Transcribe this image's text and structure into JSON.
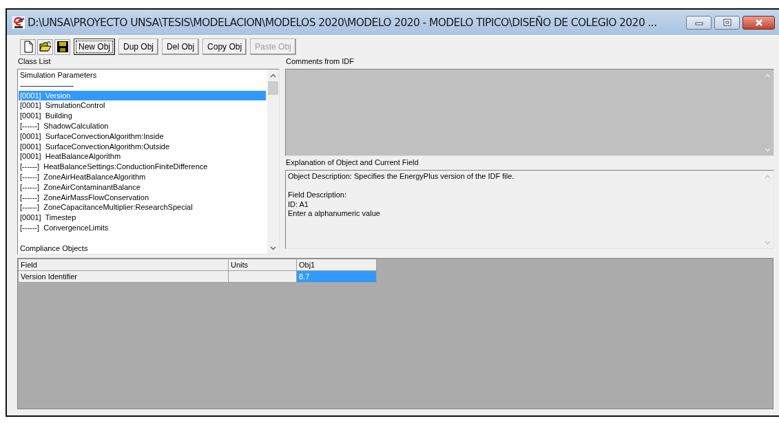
{
  "window": {
    "title": "D:\\UNSA\\PROYECTO UNSA\\TESIS\\MODELACION\\MODELOS 2020\\MODELO 2020 - MODELO TIPICO\\DISEÑO DE COLEGIO 2020 ..."
  },
  "toolbar": {
    "buttons": [
      {
        "label": "New Obj",
        "disabled": false,
        "focused": true
      },
      {
        "label": "Dup Obj",
        "disabled": false,
        "focused": false
      },
      {
        "label": "Del Obj",
        "disabled": false,
        "focused": false
      },
      {
        "label": "Copy Obj",
        "disabled": false,
        "focused": false
      },
      {
        "label": "Paste Obj",
        "disabled": true,
        "focused": false
      }
    ]
  },
  "class_list": {
    "label": "Class List",
    "items": [
      {
        "kind": "group",
        "text": "Simulation Parameters"
      },
      {
        "kind": "separator",
        "text": "-----------------------------"
      },
      {
        "kind": "class",
        "count": "[0001]",
        "name": "Version",
        "selected": true
      },
      {
        "kind": "class",
        "count": "[0001]",
        "name": "SimulationControl",
        "selected": false
      },
      {
        "kind": "class",
        "count": "[0001]",
        "name": "Building",
        "selected": false
      },
      {
        "kind": "class",
        "count": "[------]",
        "name": "ShadowCalculation",
        "selected": false
      },
      {
        "kind": "class",
        "count": "[0001]",
        "name": "SurfaceConvectionAlgorithm:Inside",
        "selected": false
      },
      {
        "kind": "class",
        "count": "[0001]",
        "name": "SurfaceConvectionAlgorithm:Outside",
        "selected": false
      },
      {
        "kind": "class",
        "count": "[0001]",
        "name": "HeatBalanceAlgorithm",
        "selected": false
      },
      {
        "kind": "class",
        "count": "[------]",
        "name": "HeatBalanceSettings:ConductionFiniteDifference",
        "selected": false
      },
      {
        "kind": "class",
        "count": "[------]",
        "name": "ZoneAirHeatBalanceAlgorithm",
        "selected": false
      },
      {
        "kind": "class",
        "count": "[------]",
        "name": "ZoneAirContaminantBalance",
        "selected": false
      },
      {
        "kind": "class",
        "count": "[------]",
        "name": "ZoneAirMassFlowConservation",
        "selected": false
      },
      {
        "kind": "class",
        "count": "[------]",
        "name": "ZoneCapacitanceMultiplier:ResearchSpecial",
        "selected": false
      },
      {
        "kind": "class",
        "count": "[0001]",
        "name": "Timestep",
        "selected": false
      },
      {
        "kind": "class",
        "count": "[------]",
        "name": "ConvergenceLimits",
        "selected": false
      },
      {
        "kind": "spacer"
      },
      {
        "kind": "group",
        "text": "Compliance Objects"
      }
    ]
  },
  "comments": {
    "label": "Comments from IDF",
    "disabled": true
  },
  "explanation": {
    "label": "Explanation of Object and Current Field",
    "disabled": false,
    "paragraphs": [
      [
        "Object Description: Specifies the EnergyPlus version of the IDF file."
      ],
      [
        "Field Description:",
        "ID: A1",
        "Enter a alphanumeric value"
      ]
    ]
  },
  "grid": {
    "columns": [
      "Field",
      "Units",
      "Obj1"
    ],
    "rows": [
      {
        "field": "Version Identifier",
        "values": [
          {
            "text": "8.7",
            "selected": true
          }
        ]
      }
    ]
  }
}
